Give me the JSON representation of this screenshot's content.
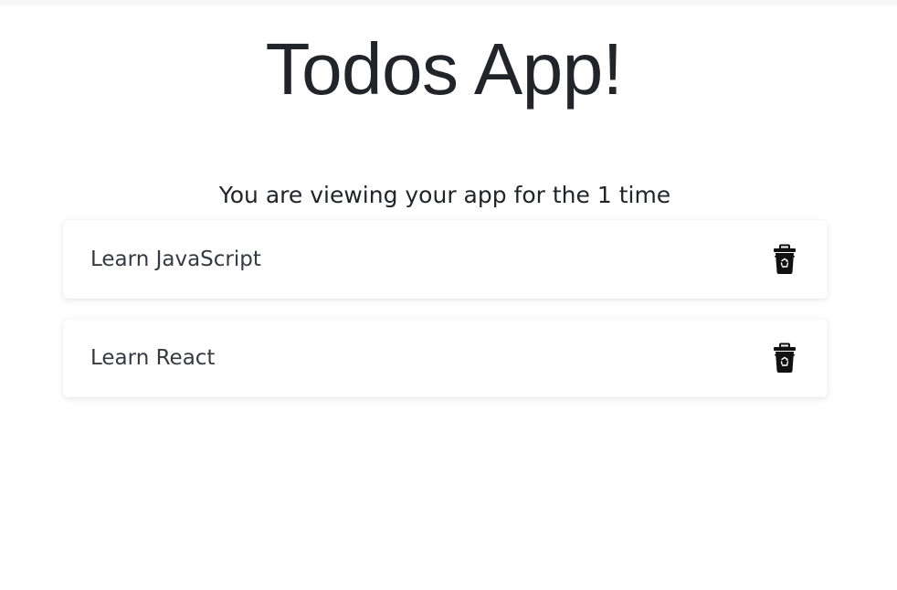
{
  "header": {
    "title": "Todos App!",
    "view_counter": "You are viewing your app for the 1 time"
  },
  "todos": [
    {
      "text": "Learn JavaScript",
      "delete_icon": "trash-can-icon"
    },
    {
      "text": "Learn React",
      "delete_icon": "trash-can-icon"
    }
  ],
  "colors": {
    "text": "#212529",
    "icon": "#111111",
    "card_background": "#ffffff"
  }
}
